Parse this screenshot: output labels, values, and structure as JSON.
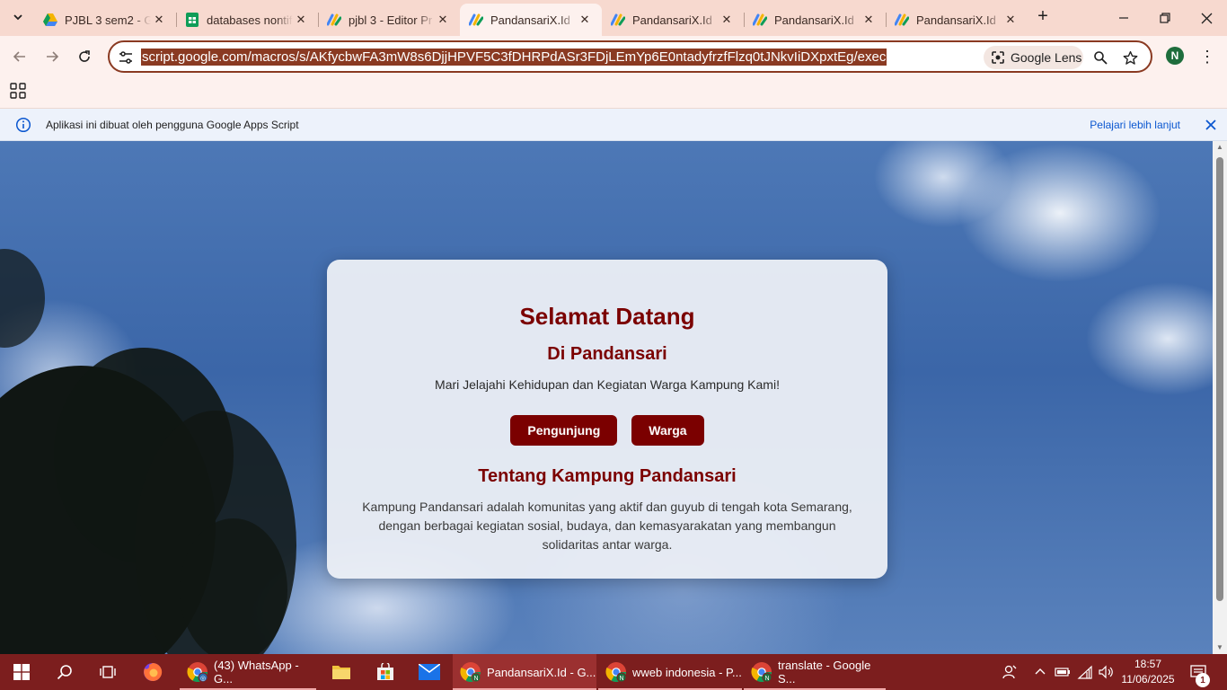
{
  "browser": {
    "tabs": [
      {
        "title": "PJBL 3 sem2 - Go",
        "icon": "google-drive-icon",
        "active": false
      },
      {
        "title": "databases nontif",
        "icon": "google-sheets-icon",
        "active": false
      },
      {
        "title": "pjbl 3 - Editor Pr",
        "icon": "apps-script-icon",
        "active": false
      },
      {
        "title": "PandansariX.Id",
        "icon": "apps-script-icon",
        "active": true
      },
      {
        "title": "PandansariX.Id",
        "icon": "apps-script-icon",
        "active": false
      },
      {
        "title": "PandansariX.Id",
        "icon": "apps-script-icon",
        "active": false
      },
      {
        "title": "PandansariX.Id",
        "icon": "apps-script-icon",
        "active": false
      }
    ],
    "url": "script.google.com/macros/s/AKfycbwFA3mW8s6DjjHPVF5C3fDHRPdASr3FDjLEmYp6E0ntadyfrzfFlzq0tJNkvIiDXpxtEg/exec",
    "lens_label": "Google Lens",
    "profile_initial": "N",
    "infobar": {
      "text": "Aplikasi ini dibuat oleh pengguna Google Apps Script",
      "link": "Pelajari lebih lanjut"
    }
  },
  "page": {
    "title": "Selamat Datang",
    "subtitle": "Di Pandansari",
    "tagline": "Mari Jelajahi Kehidupan dan Kegiatan Warga Kampung Kami!",
    "buttons": {
      "visitor": "Pengunjung",
      "resident": "Warga"
    },
    "about_heading": "Tentang Kampung Pandansari",
    "about_text": "Kampung Pandansari adalah komunitas yang aktif dan guyub di tengah kota Semarang, dengan berbagai kegiatan sosial, budaya, dan kemasyarakatan yang membangun solidaritas antar warga."
  },
  "taskbar": {
    "apps": [
      {
        "label": "(43) WhatsApp - G...",
        "icon": "chrome-icon"
      },
      {
        "label": "PandansariX.Id - G...",
        "icon": "chrome-icon"
      },
      {
        "label": "wweb indonesia - P...",
        "icon": "chrome-icon"
      },
      {
        "label": "translate - Google S...",
        "icon": "chrome-icon"
      }
    ],
    "time": "18:57",
    "date": "11/06/2025",
    "notification_count": "1"
  },
  "colors": {
    "brand": "#7b0000",
    "url_highlight": "#8a3a22",
    "taskbar": "#7c1e1e",
    "link": "#0b57d0"
  }
}
